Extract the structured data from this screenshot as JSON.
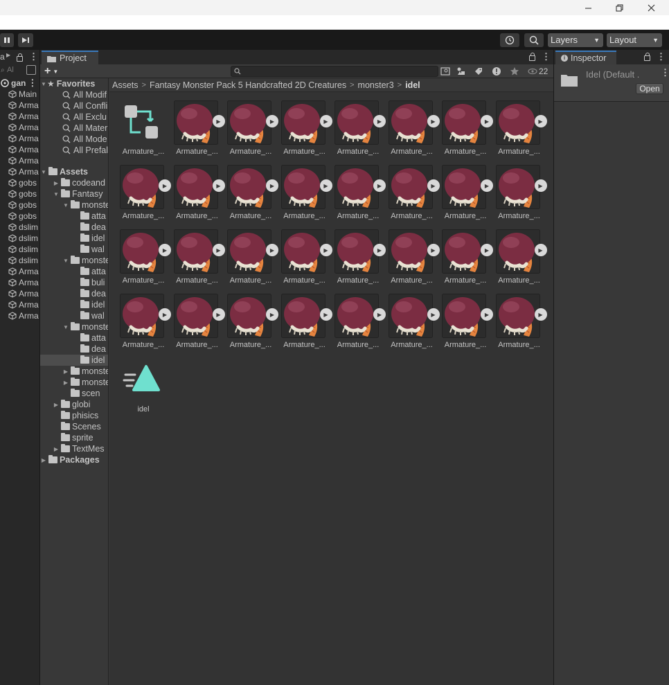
{
  "hierarchy": {
    "tab_label": "a",
    "search_placeholder": "Al",
    "scene_label": "gan",
    "items": [
      "Main",
      "Arma",
      "Arma",
      "Arma",
      "Arma",
      "Arma",
      "Arma",
      "Arma",
      "gobs",
      "gobs",
      "gobs",
      "gobs",
      "dslim",
      "dslim",
      "dslim",
      "dslim",
      "Arma",
      "Arma",
      "Arma",
      "Arma",
      "Arma"
    ]
  },
  "toolbar": {
    "layers_label": "Layers",
    "layout_label": "Layout"
  },
  "project": {
    "tab_label": "Project",
    "visible_count": "22",
    "favorites": {
      "header": "Favorites",
      "items": [
        "All Modif",
        "All Confli",
        "All Exclu",
        "All Mater",
        "All Mode",
        "All Prefal"
      ]
    },
    "tree": {
      "assets_label": "Assets",
      "rows": [
        {
          "label": "codeand",
          "indent": 1,
          "arrow": "right"
        },
        {
          "label": "Fantasy",
          "indent": 1,
          "arrow": "down"
        },
        {
          "label": "monstel",
          "indent": 2,
          "arrow": "down"
        },
        {
          "label": "atta",
          "indent": 3,
          "arrow": ""
        },
        {
          "label": "dea",
          "indent": 3,
          "arrow": ""
        },
        {
          "label": "idel",
          "indent": 3,
          "arrow": ""
        },
        {
          "label": "wal",
          "indent": 3,
          "arrow": ""
        },
        {
          "label": "monstel",
          "indent": 2,
          "arrow": "down"
        },
        {
          "label": "atta",
          "indent": 3,
          "arrow": ""
        },
        {
          "label": "buli",
          "indent": 3,
          "arrow": ""
        },
        {
          "label": "dea",
          "indent": 3,
          "arrow": ""
        },
        {
          "label": "idel",
          "indent": 3,
          "arrow": ""
        },
        {
          "label": "wal",
          "indent": 3,
          "arrow": ""
        },
        {
          "label": "monstel",
          "indent": 2,
          "arrow": "down"
        },
        {
          "label": "atta",
          "indent": 3,
          "arrow": ""
        },
        {
          "label": "dea",
          "indent": 3,
          "arrow": ""
        },
        {
          "label": "idel",
          "indent": 3,
          "arrow": "",
          "selected": true
        },
        {
          "label": "monstel",
          "indent": 2,
          "arrow": "right"
        },
        {
          "label": "monstel",
          "indent": 2,
          "arrow": "right"
        },
        {
          "label": "scen",
          "indent": 2,
          "arrow": ""
        },
        {
          "label": "globi",
          "indent": 1,
          "arrow": "right"
        },
        {
          "label": "phisics",
          "indent": 1,
          "arrow": ""
        },
        {
          "label": "Scenes",
          "indent": 1,
          "arrow": ""
        },
        {
          "label": "sprite",
          "indent": 1,
          "arrow": ""
        },
        {
          "label": "TextMes",
          "indent": 1,
          "arrow": "right"
        }
      ],
      "packages_label": "Packages"
    },
    "breadcrumb": [
      "Assets",
      "Fantasy Monster Pack 5 Handcrafted 2D Creatures",
      "monster3",
      "idel"
    ],
    "assets": {
      "controller_label": "Armature_...",
      "clip_label": "Armature_...",
      "clip_count": 31,
      "anim_label": "idel"
    }
  },
  "inspector": {
    "tab_label": "Inspector",
    "title": "Idel (Default .",
    "open_label": "Open"
  },
  "colors": {
    "accent": "#3a79bb",
    "monster_body": "#7b2d42",
    "monster_tail": "#e5843f",
    "anim_icon": "#6fe0cf"
  }
}
